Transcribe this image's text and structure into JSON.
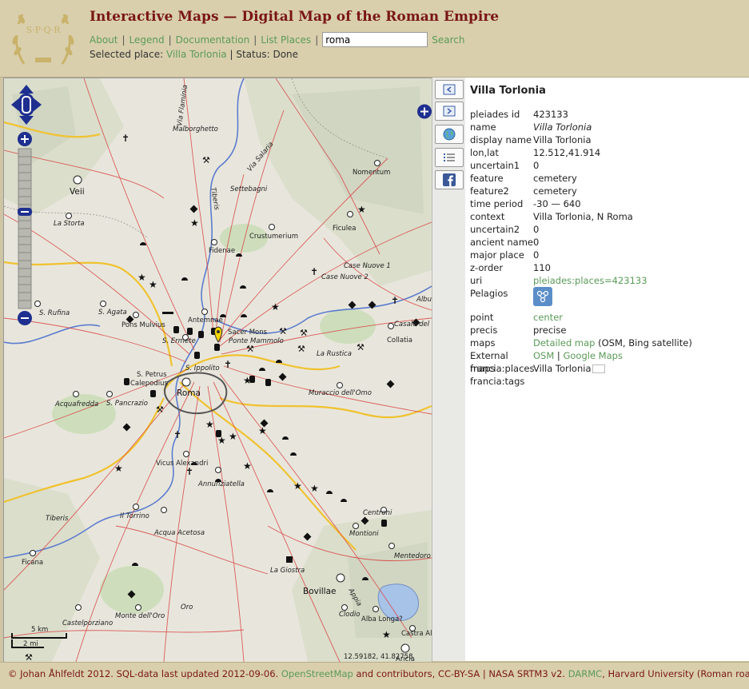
{
  "header": {
    "logo_text": "S·P·Q·R",
    "title": "Interactive Maps — Digital Map of the Roman Empire",
    "nav": [
      "About",
      "Legend",
      "Documentation",
      "List Places"
    ],
    "search_value": "roma",
    "search_button": "Search",
    "selected_label": "Selected place:",
    "selected_place": "Villa Torlonia",
    "status_label": "Status:",
    "status_value": "Done"
  },
  "map": {
    "labels": [
      {
        "text": "Via Flaminia",
        "style": "road"
      },
      {
        "text": "Malborghetto",
        "style": "it"
      },
      {
        "text": "Via Salaria",
        "style": "road"
      },
      {
        "text": "Tiberis",
        "style": "river"
      },
      {
        "text": "Nomentum",
        "style": "plain"
      },
      {
        "text": "Veii",
        "style": "big"
      },
      {
        "text": "Settebagni",
        "style": "it"
      },
      {
        "text": "La Storta",
        "style": "it"
      },
      {
        "text": "Crustumerium",
        "style": "plain"
      },
      {
        "text": "Ficulea",
        "style": "plain"
      },
      {
        "text": "Fidenae",
        "style": "plain"
      },
      {
        "text": "Case Nuove 1",
        "style": "it"
      },
      {
        "text": "Case Nuove 2",
        "style": "it"
      },
      {
        "text": "S. Rufina",
        "style": "it"
      },
      {
        "text": "S. Agata",
        "style": "it"
      },
      {
        "text": "Antemnae",
        "style": "plain"
      },
      {
        "text": "Pons Mulvius",
        "style": "plain"
      },
      {
        "text": "Sacer Mons",
        "style": "plain"
      },
      {
        "text": "Ponte Mammolo",
        "style": "it"
      },
      {
        "text": "S. Ermete",
        "style": "it"
      },
      {
        "text": "La Rustica",
        "style": "it"
      },
      {
        "text": "Collatia",
        "style": "plain"
      },
      {
        "text": "Casale del",
        "style": "it"
      },
      {
        "text": "Albu",
        "style": "it"
      },
      {
        "text": "S. Ippolito",
        "style": "it"
      },
      {
        "text": "S. Petrus",
        "style": "plain"
      },
      {
        "text": "Calepodius",
        "style": "plain"
      },
      {
        "text": "Roma",
        "style": "big"
      },
      {
        "text": "Acquafredda",
        "style": "it"
      },
      {
        "text": "S. Pancrazio",
        "style": "it"
      },
      {
        "text": "Muraccio dell'Omo",
        "style": "it"
      },
      {
        "text": "Vicus Alexandri",
        "style": "plain"
      },
      {
        "text": "Annunziatella",
        "style": "it"
      },
      {
        "text": "Tiberis",
        "style": "river"
      },
      {
        "text": "Il Torrino",
        "style": "it"
      },
      {
        "text": "Acqua Acetosa",
        "style": "it"
      },
      {
        "text": "Centroni",
        "style": "it"
      },
      {
        "text": "Montioni",
        "style": "it"
      },
      {
        "text": "Mentedoro",
        "style": "it"
      },
      {
        "text": "Ficana",
        "style": "plain"
      },
      {
        "text": "La Giostra",
        "style": "it"
      },
      {
        "text": "Bovillae",
        "style": "big"
      },
      {
        "text": "Appia",
        "style": "road"
      },
      {
        "text": "Castelporziano",
        "style": "it"
      },
      {
        "text": "Monte dell'Oro",
        "style": "it"
      },
      {
        "text": "Oro",
        "style": "it"
      },
      {
        "text": "Clodio",
        "style": "it"
      },
      {
        "text": "Alba Longa?",
        "style": "plain"
      },
      {
        "text": "Castra All",
        "style": "plain"
      },
      {
        "text": "Aricia",
        "style": "plain"
      }
    ],
    "scale_km": "5 km",
    "scale_mi": "2 mi",
    "coords": "12.59182, 41.82758"
  },
  "info": {
    "title": "Villa Torlonia",
    "rows": [
      {
        "k": "pleiades id",
        "v": "423133"
      },
      {
        "k": "name",
        "v": "Villa Torlonia",
        "italic": true
      },
      {
        "k": "display name",
        "v": "Villa Torlonia"
      },
      {
        "k": "lon,lat",
        "v": "12.512,41.914"
      },
      {
        "k": "uncertain1",
        "v": "0"
      },
      {
        "k": "feature",
        "v": "cemetery"
      },
      {
        "k": "feature2",
        "v": "cemetery"
      },
      {
        "k": "time period",
        "v": "-30 — 640"
      },
      {
        "k": "context",
        "v": "Villa Torlonia, N Roma"
      },
      {
        "k": "uncertain2",
        "v": "0"
      },
      {
        "k": "ancient name",
        "v": "0"
      },
      {
        "k": "major place",
        "v": "0"
      },
      {
        "k": "z-order",
        "v": "110"
      },
      {
        "k": "uri",
        "v": "pleiades:places=423133",
        "link": true
      }
    ],
    "pelagios_label": "Pelagios",
    "point_label": "point",
    "point_value": "center",
    "precis_label": "precis",
    "precis_value": "precise",
    "maps_label": "maps",
    "maps_link": "Detailed map",
    "maps_suffix": "(OSM, Bing satellite)",
    "external_label": "External maps",
    "external_osm": "OSM",
    "external_google": "Google Maps",
    "francia_places_label": "francia:places",
    "francia_places_value": "Villa Torlonia",
    "francia_tags_label": "francia:tags"
  },
  "footer": {
    "prefix": "© Johan Åhlfeldt 2012. SQL-data last updated 2012-09-06.",
    "osm": "OpenStreetMap",
    "mid": "and contributors, CC-BY-SA | NASA SRTM3 v2.",
    "darmc": "DARMC",
    "suffix": ", Harvard University (Roman roads)"
  },
  "colors": {
    "title": "#7a1616",
    "link": "#5a9a58",
    "header_bg": "#d9cfad",
    "road": "#d93b3b",
    "highway": "#f2c230",
    "river": "#4f6fc8"
  }
}
